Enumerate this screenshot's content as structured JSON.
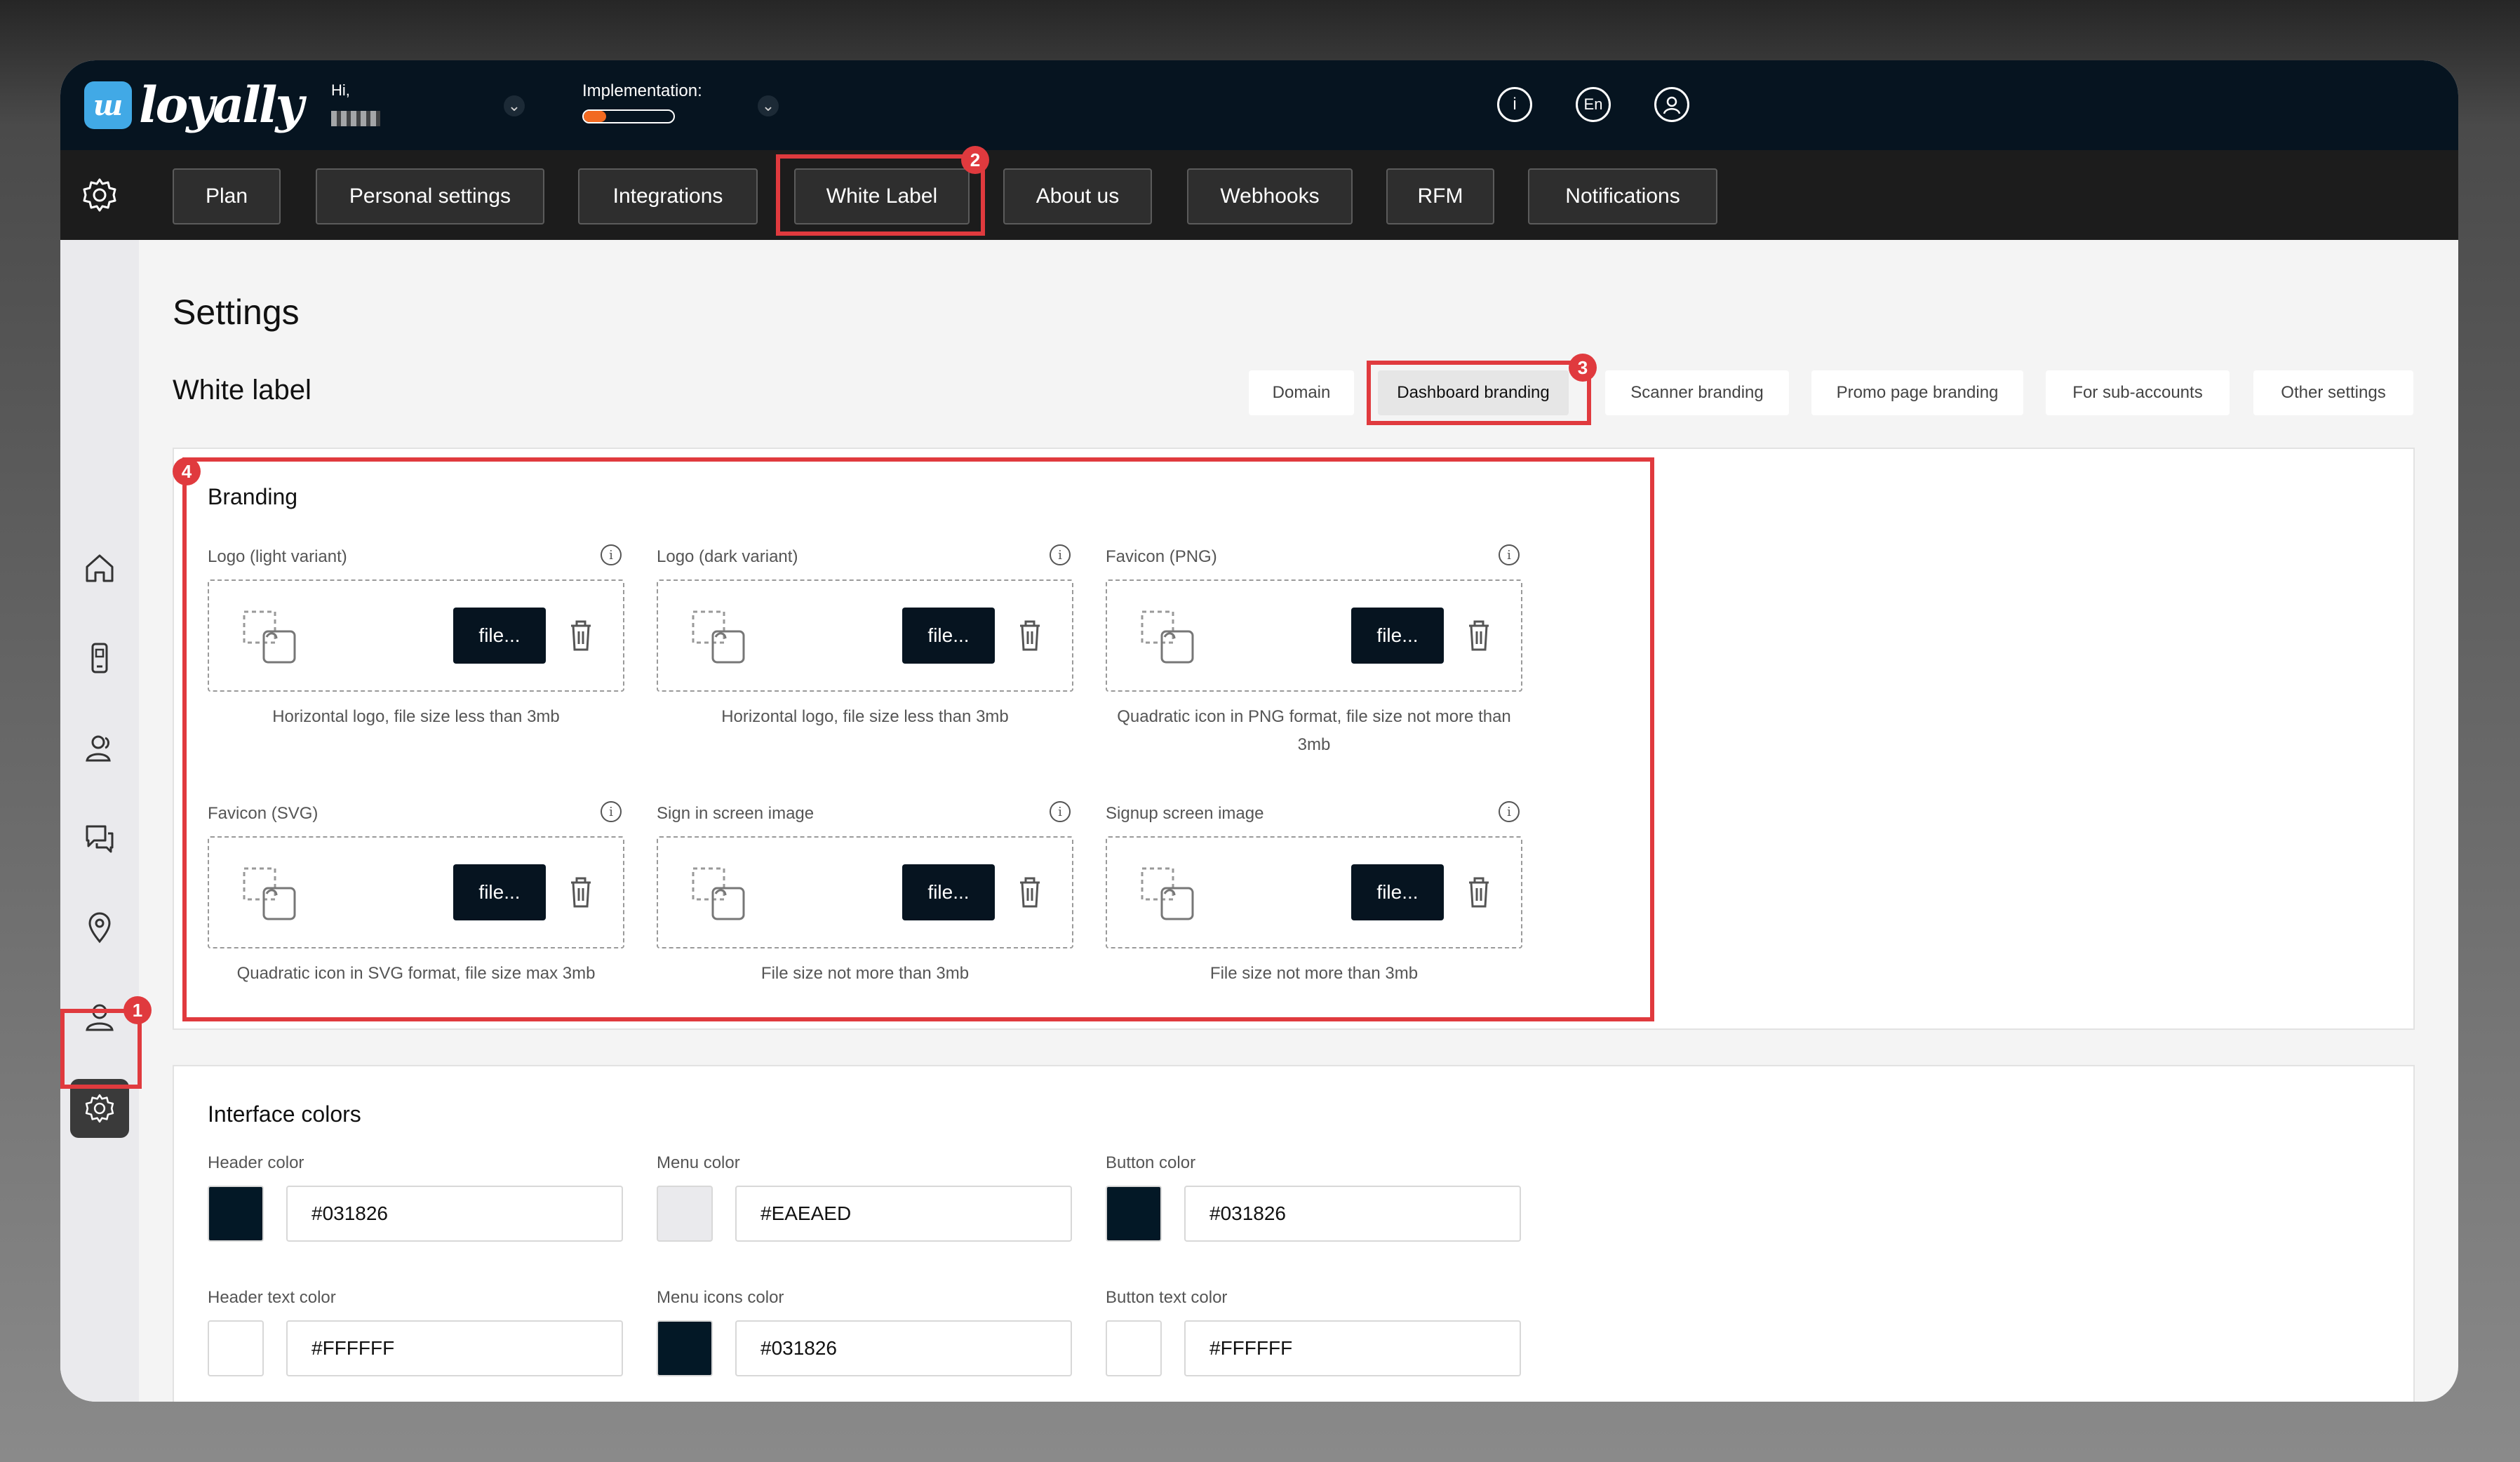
{
  "app": {
    "logo_mark": "ш",
    "logo_text": "loyally",
    "greeting": "Hi,",
    "implementation_label": "Implementation:",
    "implementation_progress": 0.25,
    "language": "En",
    "accent_color": "#f26a21"
  },
  "top_icons": [
    "info-icon",
    "language-icon",
    "user-icon"
  ],
  "nav": {
    "tabs": [
      {
        "label": "Plan"
      },
      {
        "label": "Personal settings"
      },
      {
        "label": "Integrations"
      },
      {
        "label": "White Label"
      },
      {
        "label": "About us"
      },
      {
        "label": "Webhooks"
      },
      {
        "label": "RFM"
      },
      {
        "label": "Notifications"
      }
    ]
  },
  "sidebar": {
    "items": [
      "home-icon",
      "device-icon",
      "customers-icon",
      "chat-icon",
      "location-icon",
      "user-icon",
      "settings-icon"
    ]
  },
  "page": {
    "title": "Settings",
    "subtitle": "White label",
    "subtabs": [
      {
        "label": "Domain"
      },
      {
        "label": "Dashboard branding"
      },
      {
        "label": "Scanner branding"
      },
      {
        "label": "Promo page branding"
      },
      {
        "label": "For sub-accounts"
      },
      {
        "label": "Other settings"
      }
    ]
  },
  "branding": {
    "title": "Branding",
    "file_button": "file...",
    "fields": [
      {
        "label": "Logo (light variant)",
        "hint": "Horizontal logo, file size less than 3mb"
      },
      {
        "label": "Logo (dark variant)",
        "hint": "Horizontal logo, file size less than 3mb"
      },
      {
        "label": "Favicon (PNG)",
        "hint": "Quadratic icon in PNG format, file size not more than 3mb"
      },
      {
        "label": "Favicon (SVG)",
        "hint": "Quadratic icon in SVG format, file size max 3mb"
      },
      {
        "label": "Sign in screen image",
        "hint": "File size not more than 3mb"
      },
      {
        "label": "Signup screen image",
        "hint": "File size not more than 3mb"
      }
    ]
  },
  "colors": {
    "title": "Interface colors",
    "fields": [
      {
        "label": "Header color",
        "value": "#031826"
      },
      {
        "label": "Menu color",
        "value": "#EAEAED"
      },
      {
        "label": "Button color",
        "value": "#031826"
      },
      {
        "label": "Header text color",
        "value": "#FFFFFF"
      },
      {
        "label": "Menu icons color",
        "value": "#031826"
      },
      {
        "label": "Button text color",
        "value": "#FFFFFF"
      }
    ]
  },
  "annotations": [
    "1",
    "2",
    "3",
    "4"
  ]
}
